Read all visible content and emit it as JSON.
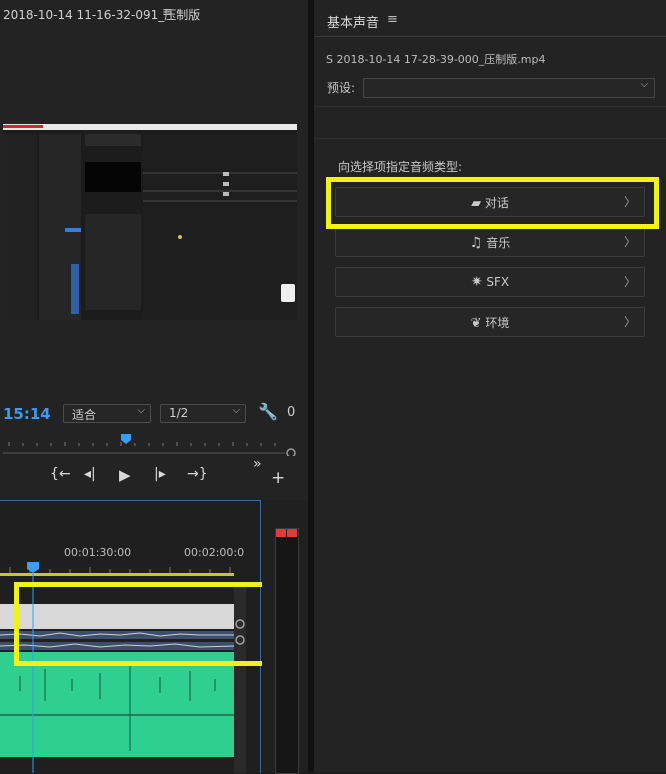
{
  "monitor": {
    "title": "2018-10-14 11-16-32-091_压制版",
    "menu_icon": "hamburger-icon",
    "timecode": "15:14",
    "fit_dropdown": "适合",
    "resolution_dropdown": "1/2",
    "settings_icon": "wrench-icon",
    "trailing_timecode": "0",
    "transport": {
      "mark_in": "{←",
      "step_back": "◂|",
      "play": "▶",
      "step_forward": "|▸",
      "mark_out": "→}",
      "more": "»",
      "add": "+"
    }
  },
  "timeline": {
    "time_labels": [
      "00:01:30:00",
      "00:02:00:0"
    ]
  },
  "essential_sound": {
    "panel_title": "基本声音",
    "menu_icon": "hamburger-icon",
    "clip_name": "S 2018-10-14 17-28-39-000_压制版.mp4",
    "preset_label": "预设:",
    "preset_value": "",
    "instruction": "向选择项指定音频类型:",
    "types": [
      {
        "label": "对话",
        "icon": "speech-bubble-icon"
      },
      {
        "label": "音乐",
        "icon": "music-note-icon"
      },
      {
        "label": "SFX",
        "icon": "burst-icon"
      },
      {
        "label": "环境",
        "icon": "leaf-icon"
      }
    ]
  },
  "colors": {
    "highlight": "#f4f01a",
    "accent": "#3d9cf2",
    "audio_track": "#2fd08f"
  }
}
